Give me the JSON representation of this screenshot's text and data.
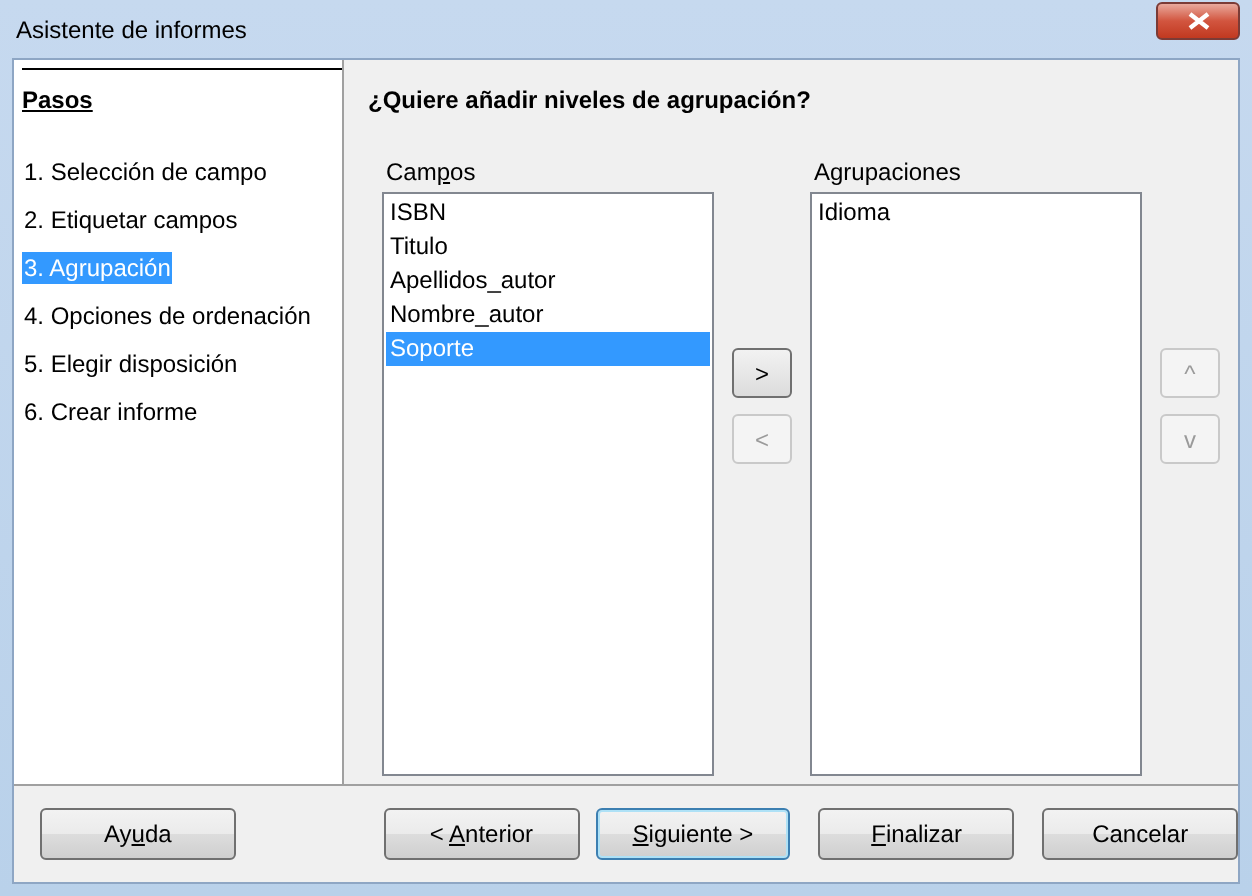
{
  "window": {
    "title": "Asistente de informes"
  },
  "steps_heading": "Pasos",
  "steps": [
    {
      "label": "1. Selección de campo",
      "selected": false
    },
    {
      "label": "2. Etiquetar campos",
      "selected": false
    },
    {
      "label": "3. Agrupación",
      "selected": true
    },
    {
      "label": "4. Opciones de ordenación",
      "selected": false
    },
    {
      "label": "5. Elegir disposición",
      "selected": false
    },
    {
      "label": "6. Crear informe",
      "selected": false
    }
  ],
  "page_heading": "¿Quiere añadir niveles de agrupación?",
  "fields": {
    "label": {
      "before": "Cam",
      "key": "p",
      "after": "os"
    },
    "items": [
      {
        "label": "ISBN",
        "selected": false
      },
      {
        "label": "Titulo",
        "selected": false
      },
      {
        "label": "Apellidos_autor",
        "selected": false
      },
      {
        "label": "Nombre_autor",
        "selected": false
      },
      {
        "label": "Soporte",
        "selected": true
      }
    ]
  },
  "move_buttons": [
    {
      "label": ">",
      "disabled": false
    },
    {
      "label": "<",
      "disabled": true
    }
  ],
  "groupings": {
    "label": "Agrupaciones",
    "items": [
      {
        "label": "Idioma",
        "selected": false
      }
    ]
  },
  "order_buttons": [
    {
      "label": "^",
      "disabled": true
    },
    {
      "label": "v",
      "disabled": true
    }
  ],
  "buttons": [
    {
      "label": {
        "before": "Ay",
        "key": "u",
        "after": "da"
      },
      "default": false
    },
    {
      "label": {
        "before": "< ",
        "key": "A",
        "after": "nterior"
      },
      "default": false
    },
    {
      "label": {
        "key": "S",
        "after": "iguiente >"
      },
      "default": true
    },
    {
      "label": {
        "key": "F",
        "after": "inalizar"
      },
      "default": false
    },
    {
      "label": "Cancelar",
      "default": false
    }
  ]
}
